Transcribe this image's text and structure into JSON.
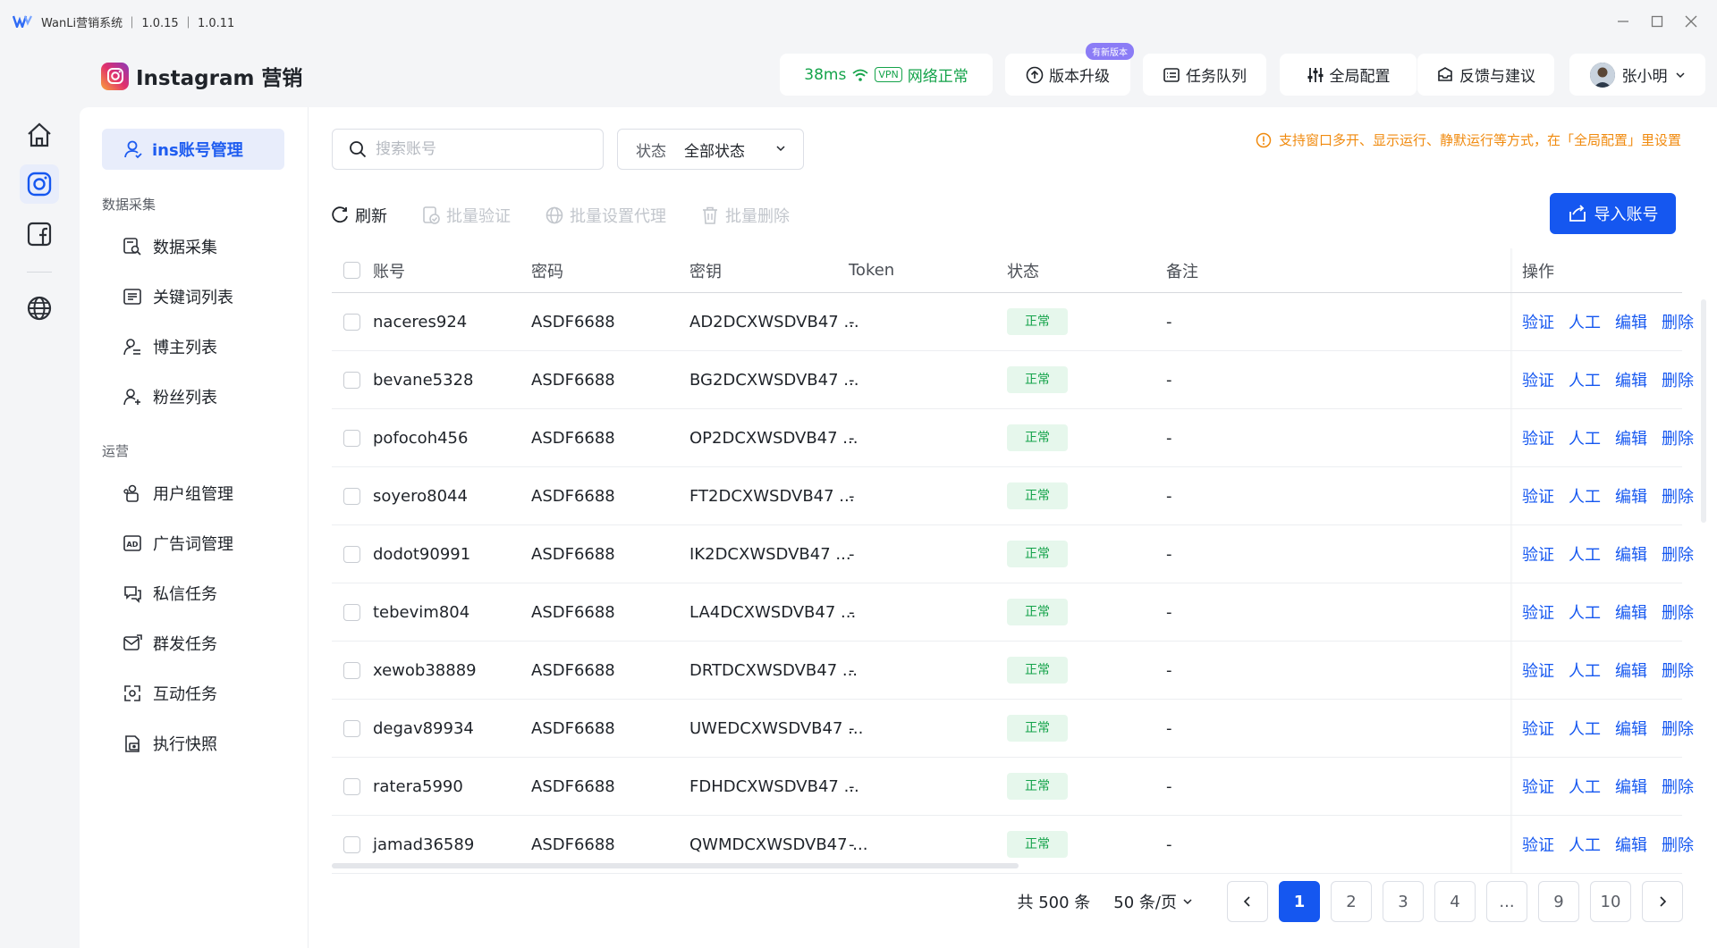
{
  "window": {
    "title": "WanLi营销系统 ｜ 1.0.15 ｜ 1.0.11"
  },
  "header": {
    "brand_title": "Instagram 营销",
    "latency": "38ms",
    "vpn": "VPN",
    "network_status": "网络正常",
    "upgrade_label": "版本升级",
    "upgrade_badge": "有新版本",
    "task_queue_label": "任务队列",
    "global_config_label": "全局配置",
    "feedback_label": "反馈与建议",
    "user_name": "张小明"
  },
  "sidebar": {
    "active_label": "ins账号管理",
    "group1": "数据采集",
    "group1_items": [
      "数据采集",
      "关键词列表",
      "博主列表",
      "粉丝列表"
    ],
    "group2": "运营",
    "group2_items": [
      "用户组管理",
      "广告词管理",
      "私信任务",
      "群发任务",
      "互动任务",
      "执行快照"
    ]
  },
  "filters": {
    "search_placeholder": "搜索账号",
    "status_label": "状态",
    "status_value": "全部状态",
    "tip": "支持窗口多开、显示运行、静默运行等方式，在「全局配置」里设置"
  },
  "toolbar": {
    "refresh": "刷新",
    "batch_verify": "批量验证",
    "batch_proxy": "批量设置代理",
    "batch_delete": "批量删除",
    "import": "导入账号"
  },
  "table": {
    "columns": [
      "账号",
      "密码",
      "密钥",
      "Token",
      "状态",
      "备注",
      "操作"
    ],
    "actions": [
      "验证",
      "人工",
      "编辑",
      "删除"
    ],
    "rows": [
      {
        "account": "naceres924",
        "password": "ASDF6688",
        "key": "AD2DCXWSDVB47 ...",
        "token": "-",
        "status": "正常",
        "note": "-"
      },
      {
        "account": "bevane5328",
        "password": "ASDF6688",
        "key": "BG2DCXWSDVB47 ...",
        "token": "-",
        "status": "正常",
        "note": "-"
      },
      {
        "account": "pofocoh456",
        "password": "ASDF6688",
        "key": "OP2DCXWSDVB47 ...",
        "token": "-",
        "status": "正常",
        "note": "-"
      },
      {
        "account": "soyero8044",
        "password": "ASDF6688",
        "key": "FT2DCXWSDVB47 ...",
        "token": "-",
        "status": "正常",
        "note": "-"
      },
      {
        "account": "dodot90991",
        "password": "ASDF6688",
        "key": "IK2DCXWSDVB47 ...",
        "token": "-",
        "status": "正常",
        "note": "-"
      },
      {
        "account": "tebevim804",
        "password": "ASDF6688",
        "key": "LA4DCXWSDVB47 ...",
        "token": "-",
        "status": "正常",
        "note": "-"
      },
      {
        "account": "xewob38889",
        "password": "ASDF6688",
        "key": "DRTDCXWSDVB47 ...",
        "token": "-",
        "status": "正常",
        "note": "-"
      },
      {
        "account": "degav89934",
        "password": "ASDF6688",
        "key": "UWEDCXWSDVB47 ...",
        "token": "-",
        "status": "正常",
        "note": "-"
      },
      {
        "account": "ratera5990",
        "password": "ASDF6688",
        "key": "FDHDCXWSDVB47 ...",
        "token": "-",
        "status": "正常",
        "note": "-"
      },
      {
        "account": "jamad36589",
        "password": "ASDF6688",
        "key": "QWMDCXWSDVB47 ...",
        "token": "-",
        "status": "正常",
        "note": "-"
      }
    ]
  },
  "pagination": {
    "total": "共 500 条",
    "page_size": "50 条/页",
    "pages": [
      "1",
      "2",
      "3",
      "4",
      "...",
      "9",
      "10"
    ],
    "current": "1"
  },
  "colors": {
    "primary": "#1557f0",
    "success": "#14a34a",
    "warning": "#f08a0e"
  }
}
